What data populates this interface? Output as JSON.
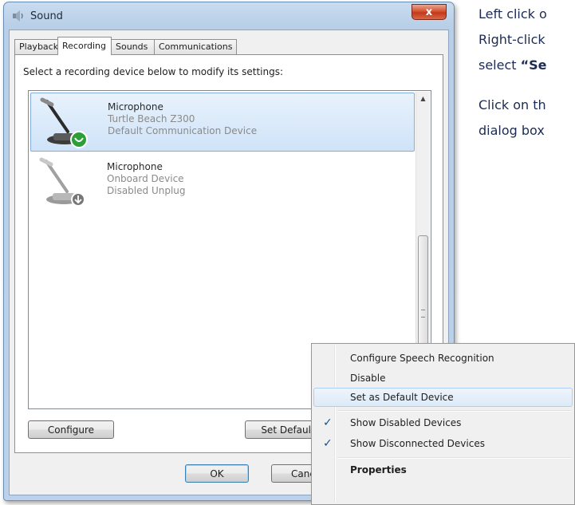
{
  "window": {
    "title": "Sound",
    "close_label": "x"
  },
  "tabs": [
    {
      "label": "Playback"
    },
    {
      "label": "Recording"
    },
    {
      "label": "Sounds"
    },
    {
      "label": "Communications"
    }
  ],
  "active_tab": "Recording",
  "instruction": "Select a recording device below to modify its settings:",
  "devices": [
    {
      "name": "Microphone",
      "detail": "Turtle Beach Z300",
      "status": "Default Communication Device",
      "icon": "microphone-icon",
      "badge": "phone-check-badge",
      "selected": true
    },
    {
      "name": "Microphone",
      "detail": "Onboard Device",
      "status": "Disabled Unplug",
      "icon": "microphone-icon",
      "badge": "down-arrow-badge",
      "selected": false
    }
  ],
  "buttons": {
    "configure": "Configure",
    "set_default": "Set Default",
    "ok": "OK",
    "cancel": "Canc"
  },
  "context_menu": {
    "items": [
      {
        "label": "Configure Speech Recognition",
        "checked": false
      },
      {
        "label": "Disable",
        "checked": false
      },
      {
        "label": "Set as Default Device",
        "checked": false,
        "highlighted": true
      },
      {
        "label": "Show Disabled Devices",
        "checked": true
      },
      {
        "label": "Show Disconnected Devices",
        "checked": true
      },
      {
        "label": "Properties",
        "checked": false,
        "bold": true
      }
    ]
  },
  "side_text": {
    "line1": "Left click o",
    "line2": "Right-click",
    "line3_prefix": "select ",
    "line3_bold": "“Se",
    "line4": "Click on th",
    "line5": "dialog box"
  },
  "colors": {
    "accent": "#3c7fb1",
    "selection": "#cfe3f8",
    "side_text": "#1c2b52",
    "close": "#c2391a"
  }
}
